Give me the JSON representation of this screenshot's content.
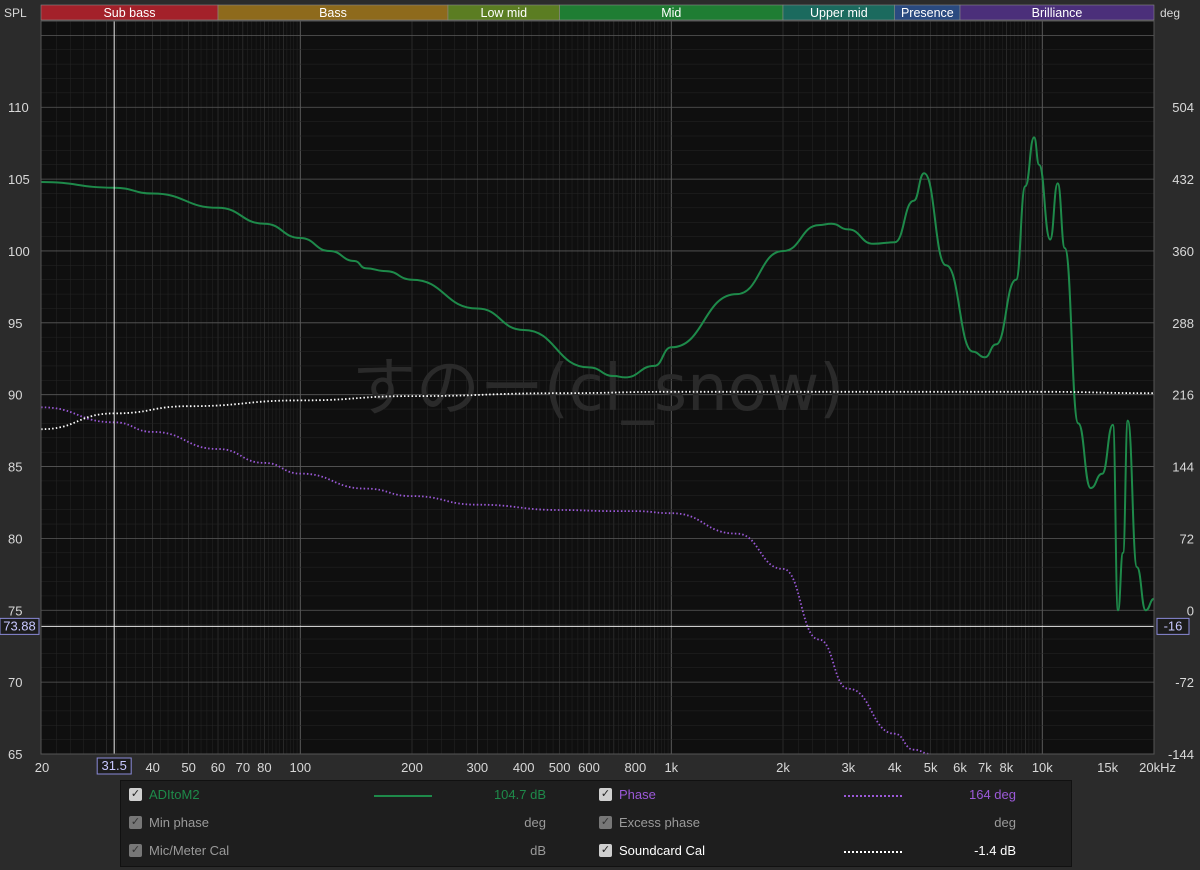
{
  "bands": [
    {
      "name": "Sub bass",
      "color": "#a3212a"
    },
    {
      "name": "Bass",
      "color": "#8e6a1c"
    },
    {
      "name": "Low mid",
      "color": "#5b7d22"
    },
    {
      "name": "Mid",
      "color": "#1f7d33"
    },
    {
      "name": "Upper mid",
      "color": "#1b6a5e"
    },
    {
      "name": "Presence",
      "color": "#2a4a80"
    },
    {
      "name": "Brilliance",
      "color": "#4b2f7a"
    }
  ],
  "axis": {
    "left_title": "SPL",
    "right_title": "deg",
    "y_ticks": [
      "110",
      "105",
      "100",
      "95",
      "90",
      "85",
      "80",
      "75",
      "70",
      "65"
    ],
    "y2_ticks": [
      "504",
      "432",
      "360",
      "288",
      "216",
      "144",
      "72",
      "0",
      "-72",
      "-144"
    ],
    "x_ticks": [
      "20",
      "40",
      "50",
      "60",
      "70",
      "80",
      "100",
      "200",
      "300",
      "400",
      "500",
      "600",
      "800",
      "1k",
      "2k",
      "3k",
      "4k",
      "5k",
      "6k",
      "7k",
      "8k",
      "10k",
      "15k",
      "20kHz"
    ],
    "cursor_freq_label": "31.5",
    "cursor_spl_label": "73.88",
    "cursor_deg_label": "-16"
  },
  "watermark": "すのー(cl_snow)",
  "colors": {
    "plot_bg": "#0f0f0f",
    "spl": "#1e8a4a",
    "phase": "#9b59d8",
    "cal": "#ffffff",
    "grid": "#3a3a3a",
    "grid_major": "#5a5a5a",
    "cursor": "#e8e8e8",
    "text": "#d8d8d8",
    "box": "#8a8ad8"
  },
  "chart_data": {
    "type": "line",
    "xscale": "log",
    "xlim": [
      20,
      20000
    ],
    "ylim": [
      65,
      116
    ],
    "y2lim": [
      -144,
      541
    ],
    "xlabel": "",
    "ylabel": "SPL",
    "y2label": "deg",
    "grid": true,
    "series": [
      {
        "name": "ADItoM2",
        "axis": "left",
        "style": "solid",
        "color": "#1e8a4a",
        "x": [
          20,
          31.5,
          40,
          60,
          80,
          100,
          120,
          140,
          150,
          170,
          200,
          300,
          400,
          600,
          700,
          750,
          900,
          1000,
          1500,
          2000,
          2500,
          2700,
          3000,
          3500,
          4000,
          4500,
          4800,
          5500,
          6500,
          7000,
          7500,
          8500,
          9000,
          9500,
          9800,
          10500,
          11000,
          11500,
          12500,
          13500,
          14500,
          15500,
          16000,
          16500,
          17000,
          18000,
          19000,
          20000
        ],
        "y": [
          104.8,
          104.4,
          104.0,
          103.0,
          101.9,
          100.9,
          100.0,
          99.3,
          98.8,
          98.6,
          98.0,
          96.0,
          94.5,
          91.9,
          91.3,
          91.2,
          92.0,
          93.3,
          97.0,
          100.0,
          101.8,
          101.9,
          101.5,
          100.5,
          100.6,
          103.5,
          105.4,
          99.0,
          93.0,
          92.6,
          93.5,
          98.0,
          104.5,
          107.9,
          106.0,
          100.8,
          104.7,
          100.2,
          88.0,
          83.5,
          84.5,
          87.9,
          75.0,
          79.0,
          88.2,
          78.0,
          75.0,
          75.8
        ]
      },
      {
        "name": "Phase",
        "axis": "right",
        "style": "dotted",
        "color": "#9b59d8",
        "x": [
          20,
          31.5,
          40,
          60,
          80,
          100,
          150,
          200,
          300,
          500,
          700,
          800,
          1000,
          1500,
          2000,
          2500,
          3000,
          4000,
          4500,
          5000
        ],
        "y": [
          180,
          166,
          157,
          141,
          128,
          118,
          104,
          97,
          89,
          84,
          83,
          83,
          81,
          62,
          29,
          -37,
          -83,
          -125,
          -140,
          -150
        ]
      },
      {
        "name": "Soundcard Cal",
        "axis": "left",
        "style": "dotted",
        "color": "#ffffff",
        "x": [
          20,
          31.5,
          50,
          100,
          200,
          500,
          1000,
          2000,
          5000,
          10000,
          20000
        ],
        "y": [
          87.6,
          88.7,
          89.2,
          89.6,
          89.9,
          90.1,
          90.2,
          90.2,
          90.2,
          90.2,
          90.1
        ]
      }
    ]
  },
  "legend": [
    {
      "checked": true,
      "label": "ADItoM2",
      "value": "104.7 dB",
      "color": "#1e8a4a",
      "style": "solid"
    },
    {
      "checked": true,
      "label": "Phase",
      "value": "164 deg",
      "color": "#9b59d8",
      "style": "dotted"
    },
    {
      "checked": true,
      "label": "Min phase",
      "value": "deg",
      "color": "#9a9a9a",
      "style": "none",
      "dim": true
    },
    {
      "checked": true,
      "label": "Excess phase",
      "value": "deg",
      "color": "#9a9a9a",
      "style": "none",
      "dim": true
    },
    {
      "checked": true,
      "label": "Mic/Meter Cal",
      "value": "dB",
      "color": "#9a9a9a",
      "style": "none",
      "dim": true
    },
    {
      "checked": true,
      "label": "Soundcard Cal",
      "value": "-1.4 dB",
      "color": "#ffffff",
      "style": "dotted"
    }
  ]
}
